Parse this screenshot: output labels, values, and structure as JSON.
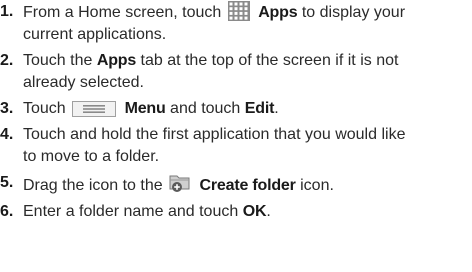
{
  "steps": [
    {
      "number": "1.",
      "line1_pre": "From a Home screen, touch",
      "icon": "apps-grid-icon",
      "line1_bold": "Apps",
      "line1_post": "to display your",
      "line2": "current applications."
    },
    {
      "number": "2.",
      "line1_pre": "Touch the",
      "line1_bold": "Apps",
      "line1_post": "tab at the top of the screen if it is not",
      "line2": "already selected."
    },
    {
      "number": "3.",
      "line1_pre": "Touch",
      "icon": "menu-key-icon",
      "line1_bold": "Menu",
      "line1_mid": "and touch",
      "line1_bold2": "Edit",
      "line1_post": "."
    },
    {
      "number": "4.",
      "line1": "Touch and hold the first application that you would like",
      "line2": "to move to a folder."
    },
    {
      "number": "5.",
      "line1_pre": "Drag the icon to the",
      "icon": "create-folder-icon",
      "line1_bold": "Create folder",
      "line1_post": "icon."
    },
    {
      "number": "6.",
      "line1_pre": "Enter a folder name and touch",
      "line1_bold": "OK",
      "line1_post": "."
    }
  ]
}
